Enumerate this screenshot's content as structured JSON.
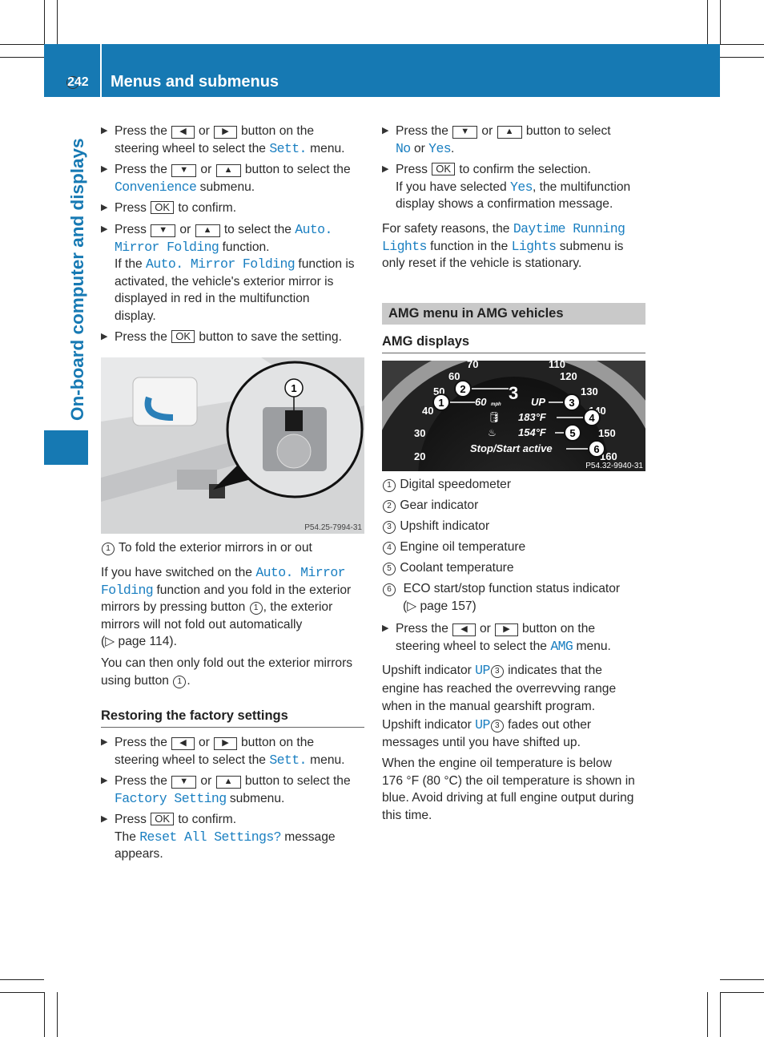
{
  "header": {
    "page_number": "242",
    "title": "Menus and submenus"
  },
  "side_tab": "On-board computer and displays",
  "left": {
    "steps1": [
      [
        "Press the ",
        {
          "btn": "◀"
        },
        " or ",
        {
          "btn": "▶"
        },
        " button on the",
        {
          "br": 1
        },
        "steering wheel to select the ",
        {
          "code": "Sett."
        },
        " menu."
      ],
      [
        "Press the ",
        {
          "btn": "▼"
        },
        " or ",
        {
          "btn": "▲"
        },
        " button to select the",
        {
          "br": 1
        },
        {
          "code": "Convenience"
        },
        " submenu."
      ],
      [
        "Press ",
        {
          "ok": "OK"
        },
        " to confirm."
      ],
      [
        "Press ",
        {
          "btn": "▼"
        },
        " or ",
        {
          "btn": "▲"
        },
        " to select the ",
        {
          "code": "Auto."
        },
        {
          "br": 1
        },
        {
          "code": "Mirror Folding"
        },
        " function.",
        {
          "br": 1
        },
        "If the ",
        {
          "code": "Auto. Mirror Folding"
        },
        " function is",
        {
          "br": 1
        },
        "activated, the vehicle's exterior mirror is",
        {
          "br": 1
        },
        "displayed in red in the multifunction",
        {
          "br": 1
        },
        "display."
      ],
      [
        "Press the ",
        {
          "ok": "OK"
        },
        " button to save the setting."
      ]
    ],
    "figure1": {
      "callout": "1",
      "ref": "P54.25-7994-31"
    },
    "legend1": [
      {
        "num": "1"
      },
      "  To fold the exterior mirrors in or out"
    ],
    "para1": [
      "If you have switched on the ",
      {
        "code": "Auto. Mirror"
      },
      {
        "br": 1
      },
      {
        "code": "Folding"
      },
      " function and you fold in the exterior",
      {
        "br": 1
      },
      "mirrors by pressing button ",
      {
        "num": "1"
      },
      ", the exterior",
      {
        "br": 1
      },
      "mirrors will not fold out automatically",
      {
        "br": 1
      },
      "(▷ page 114)."
    ],
    "para2": [
      "You can then only fold out the exterior mirrors",
      {
        "br": 1
      },
      "using button ",
      {
        "num": "1"
      },
      "."
    ],
    "heading": "Restoring the factory settings",
    "steps2": [
      [
        "Press the ",
        {
          "btn": "◀"
        },
        " or ",
        {
          "btn": "▶"
        },
        " button on the",
        {
          "br": 1
        },
        "steering wheel to select the ",
        {
          "code": "Sett."
        },
        " menu."
      ],
      [
        "Press the ",
        {
          "btn": "▼"
        },
        " or ",
        {
          "btn": "▲"
        },
        " button to select the",
        {
          "br": 1
        },
        {
          "code": "Factory Setting"
        },
        " submenu."
      ],
      [
        "Press ",
        {
          "ok": "OK"
        },
        " to confirm.",
        {
          "br": 1
        },
        "The ",
        {
          "code": "Reset All Settings?"
        },
        " message",
        {
          "br": 1
        },
        "appears."
      ]
    ]
  },
  "right": {
    "steps1": [
      [
        "Press the ",
        {
          "btn": "▼"
        },
        " or ",
        {
          "btn": "▲"
        },
        " button to select",
        {
          "br": 1
        },
        {
          "code": "No"
        },
        " or ",
        {
          "code": "Yes"
        },
        "."
      ],
      [
        "Press ",
        {
          "ok": "OK"
        },
        " to confirm the selection.",
        {
          "br": 1
        },
        "If you have selected ",
        {
          "code": "Yes"
        },
        ", the multifunction",
        {
          "br": 1
        },
        "display shows a confirmation message."
      ]
    ],
    "para1": [
      "For safety reasons, the ",
      {
        "code": "Daytime Running"
      },
      {
        "br": 1
      },
      {
        "code": "Lights"
      },
      " function in the ",
      {
        "code": "Lights"
      },
      " submenu is",
      {
        "br": 1
      },
      "only reset if the vehicle is stationary."
    ],
    "section_title": "AMG menu in AMG vehicles",
    "heading": "AMG displays",
    "figure2": {
      "ref": "P54.32-9940-31",
      "speed": "60",
      "unit": "mph",
      "gear": "3",
      "upshift": "UP",
      "oil_temp": "183°F",
      "coolant_temp": "154°F",
      "status": "Stop/Start active",
      "scale": [
        "20",
        "30",
        "40",
        "50",
        "60",
        "70",
        "110",
        "120",
        "130",
        "140",
        "150",
        "160"
      ],
      "callouts": [
        "1",
        "2",
        "3",
        "4",
        "5",
        "6"
      ]
    },
    "legend": [
      [
        {
          "num": "1"
        },
        "  Digital speedometer"
      ],
      [
        {
          "num": "2"
        },
        "  Gear indicator"
      ],
      [
        {
          "num": "3"
        },
        "  Upshift indicator"
      ],
      [
        {
          "num": "4"
        },
        "  Engine oil temperature"
      ],
      [
        {
          "num": "5"
        },
        "  Coolant temperature"
      ],
      [
        {
          "num": "6"
        },
        "  ECO start/stop function status indicator",
        {
          "br": 1
        },
        "      (▷ page 157)"
      ]
    ],
    "step2": [
      "Press the ",
      {
        "btn": "◀"
      },
      " or ",
      {
        "btn": "▶"
      },
      " button on the",
      {
        "br": 1
      },
      "steering wheel to select the ",
      {
        "code": "AMG"
      },
      " menu."
    ],
    "para2": [
      "Upshift indicator ",
      {
        "code": "UP"
      },
      {
        "num": "3"
      },
      " indicates that the",
      {
        "br": 1
      },
      "engine has reached the overrevving range",
      {
        "br": 1
      },
      "when in the manual gearshift program.",
      {
        "br": 1
      },
      "Upshift indicator ",
      {
        "code": "UP"
      },
      {
        "num": "3"
      },
      " fades out other",
      {
        "br": 1
      },
      "messages until you have shifted up."
    ],
    "para3": [
      "When the engine oil temperature is below",
      {
        "br": 1
      },
      "176 °F (80 °C) the oil temperature is shown in",
      {
        "br": 1
      },
      "blue. Avoid driving at full engine output during",
      {
        "br": 1
      },
      "this time."
    ]
  },
  "colors": {
    "brand": "#1679b3",
    "link": "#1a7fc1",
    "section_bar": "#c9c9c9"
  }
}
